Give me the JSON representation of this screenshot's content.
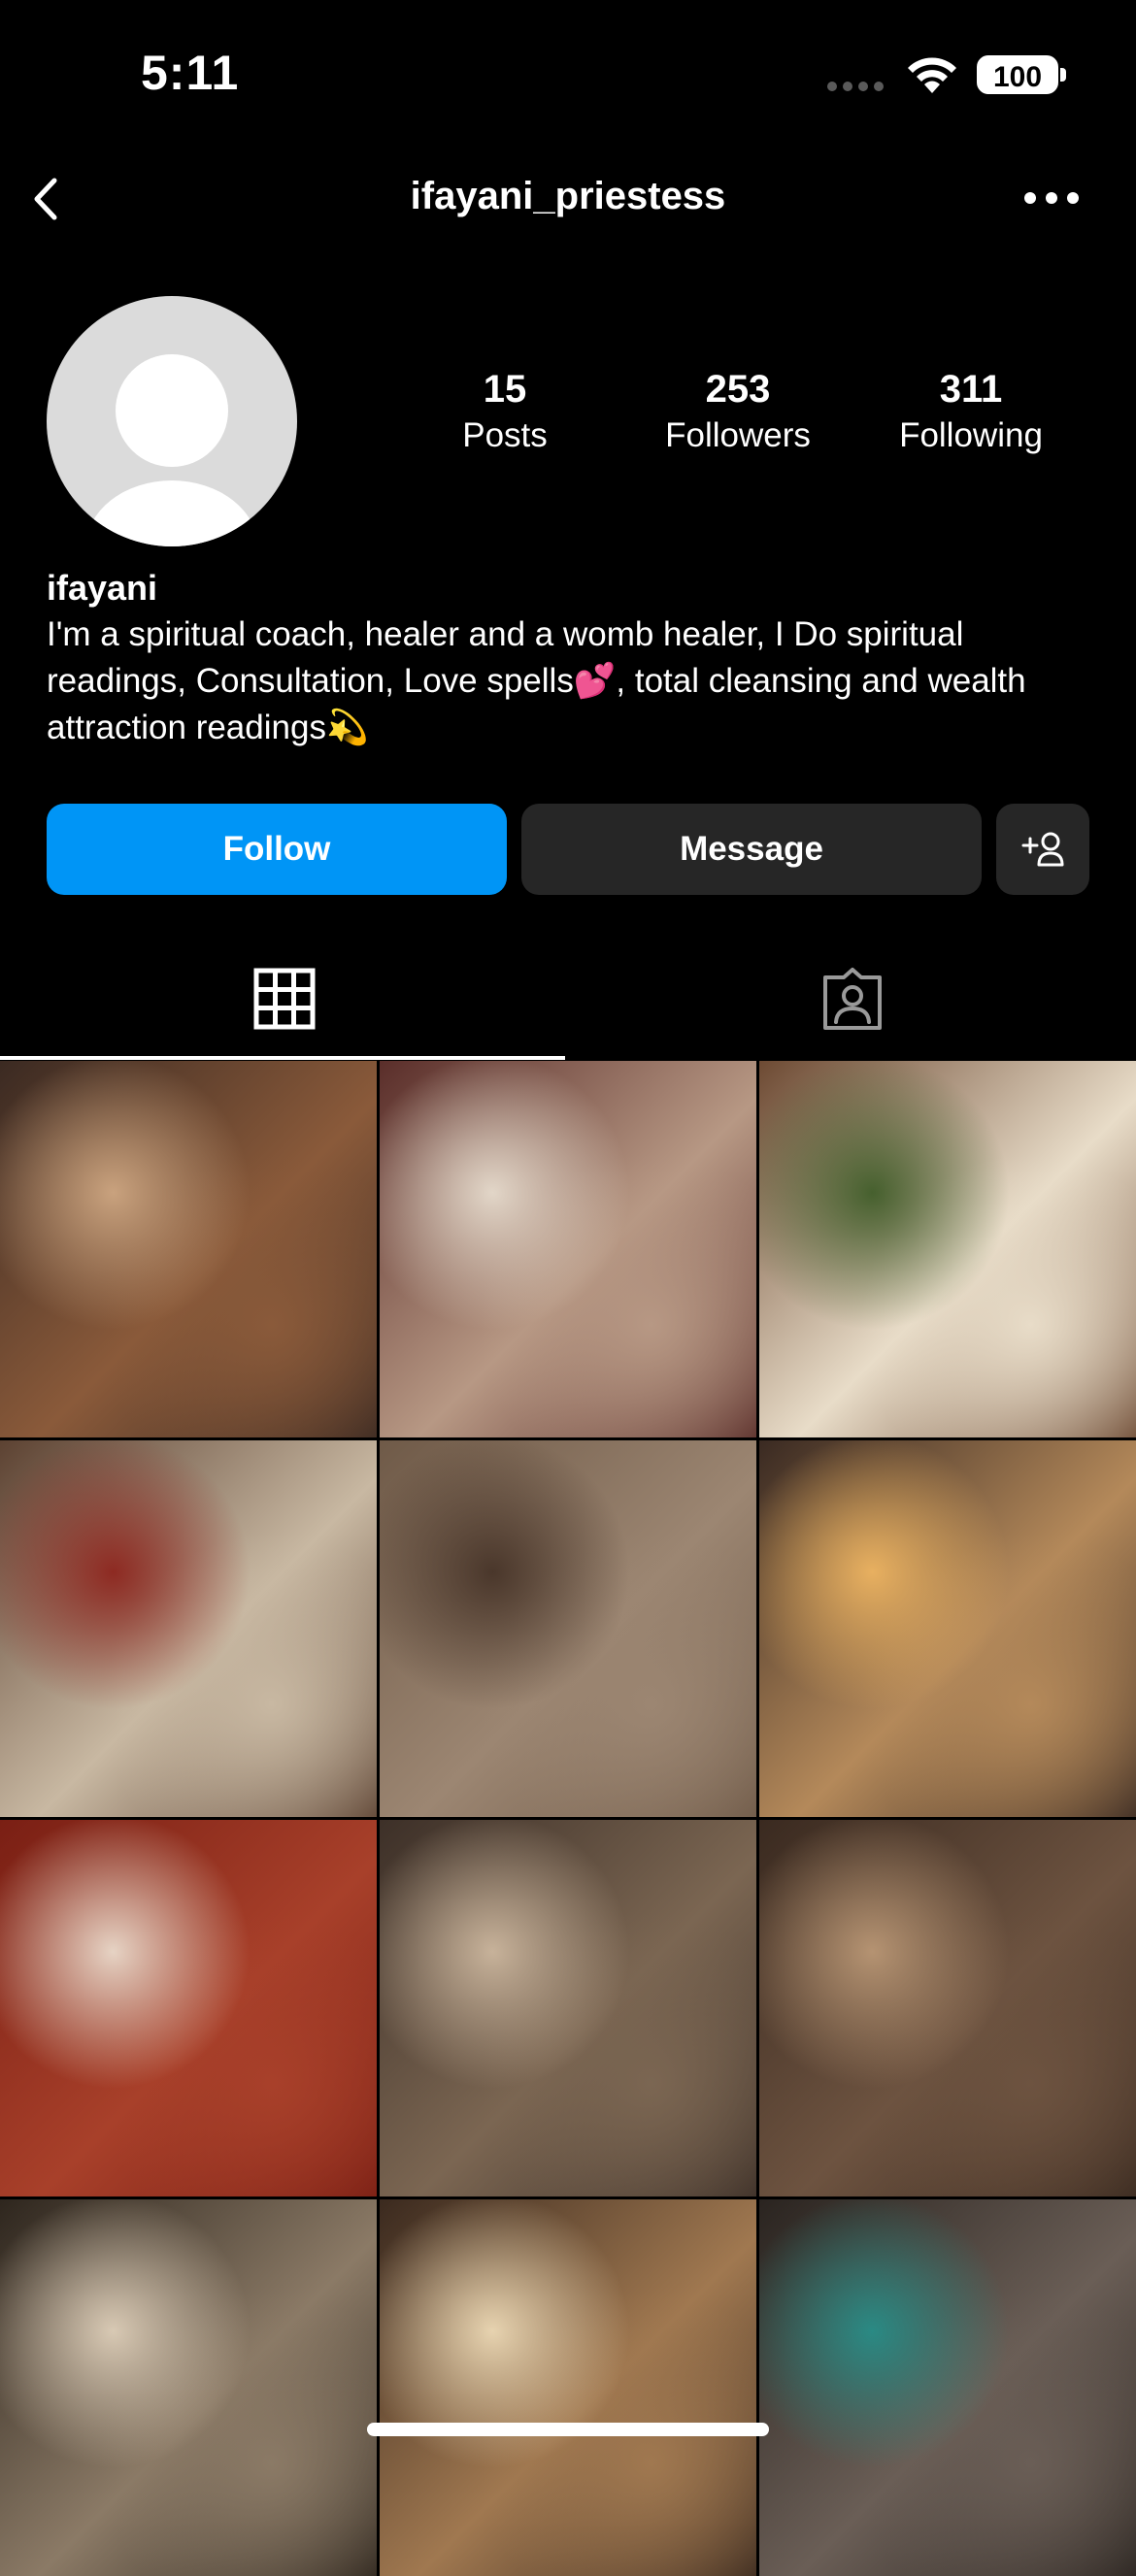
{
  "status_bar": {
    "time": "5:11",
    "battery": "100"
  },
  "header": {
    "username": "ifayani_priestess"
  },
  "profile": {
    "name": "ifayani",
    "bio": "I'm a spiritual coach, healer and a womb healer, I Do spiritual readings, Consultation, Love spells💕, total cleansing and wealth attraction readings💫",
    "stats": [
      {
        "value": "15",
        "label": "Posts"
      },
      {
        "value": "253",
        "label": "Followers"
      },
      {
        "value": "311",
        "label": "Following"
      }
    ]
  },
  "actions": {
    "follow_label": "Follow",
    "message_label": "Message"
  },
  "tabs": [
    {
      "icon": "grid-icon",
      "selected": true
    },
    {
      "icon": "tagged-icon",
      "selected": false
    }
  ],
  "colors": {
    "accent": "#0095f6",
    "button_dark": "#262626",
    "background": "#000000"
  },
  "posts": [
    {
      "icon": "photo",
      "colors": [
        "#3b2a22",
        "#8a5a3a",
        "#c9a27e"
      ]
    },
    {
      "icon": "photo",
      "colors": [
        "#5a2e2a",
        "#b79884",
        "#e2d6c8"
      ]
    },
    {
      "icon": "photo",
      "colors": [
        "#6d4a33",
        "#e8dcc8",
        "#46602e"
      ]
    },
    {
      "icon": "photo",
      "colors": [
        "#5c4232",
        "#c8b8a2",
        "#8e2a22"
      ]
    },
    {
      "icon": "photo",
      "colors": [
        "#6f5a48",
        "#9c8672",
        "#4a372b"
      ]
    },
    {
      "icon": "photo",
      "colors": [
        "#3a2a22",
        "#b4895a",
        "#e8b060"
      ]
    },
    {
      "icon": "photo",
      "colors": [
        "#7a1f14",
        "#a8402a",
        "#e6d3c4"
      ]
    },
    {
      "icon": "photo",
      "colors": [
        "#3d3028",
        "#7b6652",
        "#c7b29a"
      ]
    },
    {
      "icon": "photo",
      "colors": [
        "#3a2a20",
        "#6d5340",
        "#b59372"
      ]
    },
    {
      "icon": "photo",
      "colors": [
        "#2e261e",
        "#8b7a66",
        "#d8c9b4"
      ]
    },
    {
      "icon": "photo",
      "colors": [
        "#3b2a1f",
        "#a07850",
        "#e7d3b0"
      ]
    },
    {
      "icon": "photo",
      "colors": [
        "#2a2420",
        "#6a5e56",
        "#2a8a84"
      ]
    }
  ]
}
